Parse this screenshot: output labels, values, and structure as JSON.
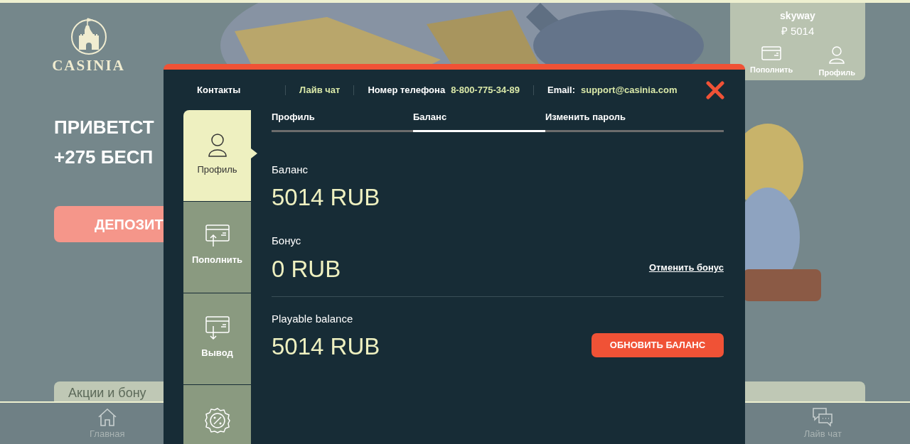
{
  "logo": {
    "text": "CASINIA"
  },
  "hero": {
    "headline_lines": [
      "ПРИВЕТСТ",
      "+275 БЕСП"
    ],
    "deposit_button": "ДЕПОЗИТ"
  },
  "promo_card": {
    "title": "Акции и бону"
  },
  "user_panel": {
    "username": "skyway",
    "balance": "₽ 5014",
    "actions": [
      {
        "label": "Пополнить",
        "kind": "card"
      },
      {
        "label": "Профиль",
        "kind": "person"
      }
    ]
  },
  "bottom_nav": [
    {
      "label": "Главная",
      "kind": "home"
    },
    {
      "label": "Лайв чат",
      "kind": "chat"
    }
  ],
  "modal": {
    "contacts": [
      {
        "label": "Контакты",
        "kind": "plain"
      },
      {
        "label": "Лайв чат",
        "kind": "link"
      },
      {
        "label": "Номер телефона",
        "value": "8-800-775-34-89",
        "kind": "pair"
      },
      {
        "label": "Email:",
        "value": "support@casinia.com",
        "kind": "pair"
      }
    ],
    "sidebar": [
      {
        "label": "Профиль",
        "kind": "profile",
        "selected": true
      },
      {
        "label": "Пополнить",
        "kind": "deposit",
        "selected": false
      },
      {
        "label": "Вывод",
        "kind": "withdraw",
        "selected": false
      },
      {
        "kind": "bonus",
        "selected": false
      }
    ],
    "tabs": [
      {
        "label": "Профиль",
        "selected": false
      },
      {
        "label": "Баланс",
        "selected": true
      },
      {
        "label": "Изменить пароль",
        "selected": false
      }
    ],
    "sections": [
      {
        "label": "Баланс",
        "amount": "5014 RUB"
      },
      {
        "label": "Бонус",
        "amount": "0 RUB",
        "action": {
          "kind": "link",
          "label": "Отменить бонус"
        }
      },
      {
        "label": "Playable balance",
        "amount": "5014 RUB",
        "divider_before": true,
        "action": {
          "kind": "button",
          "label": "ОБНОВИТЬ БАЛАНС"
        }
      }
    ]
  }
}
